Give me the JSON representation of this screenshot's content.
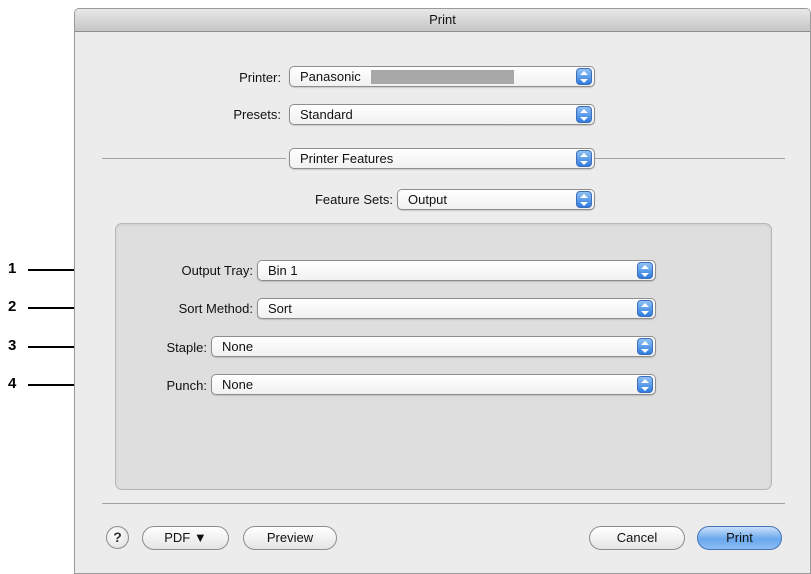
{
  "window": {
    "title": "Print"
  },
  "printer": {
    "label": "Printer:",
    "value": "Panasonic"
  },
  "presets": {
    "label": "Presets:",
    "value": "Standard"
  },
  "panel": {
    "value": "Printer Features"
  },
  "feature_sets": {
    "label": "Feature Sets:",
    "value": "Output"
  },
  "options": [
    {
      "callout": "1",
      "label": "Output Tray:",
      "value": "Bin 1"
    },
    {
      "callout": "2",
      "label": "Sort Method:",
      "value": "Sort"
    },
    {
      "callout": "3",
      "label": "Staple:",
      "value": "None"
    },
    {
      "callout": "4",
      "label": "Punch:",
      "value": "None"
    }
  ],
  "buttons": {
    "help": "?",
    "pdf": "PDF ▼",
    "preview": "Preview",
    "cancel": "Cancel",
    "print": "Print"
  },
  "icons": {
    "popup_arrows": "up-down-arrows-icon"
  },
  "colors": {
    "accent_blue": "#3a82e6",
    "window_bg": "#ececec",
    "group_bg": "#dedede"
  }
}
